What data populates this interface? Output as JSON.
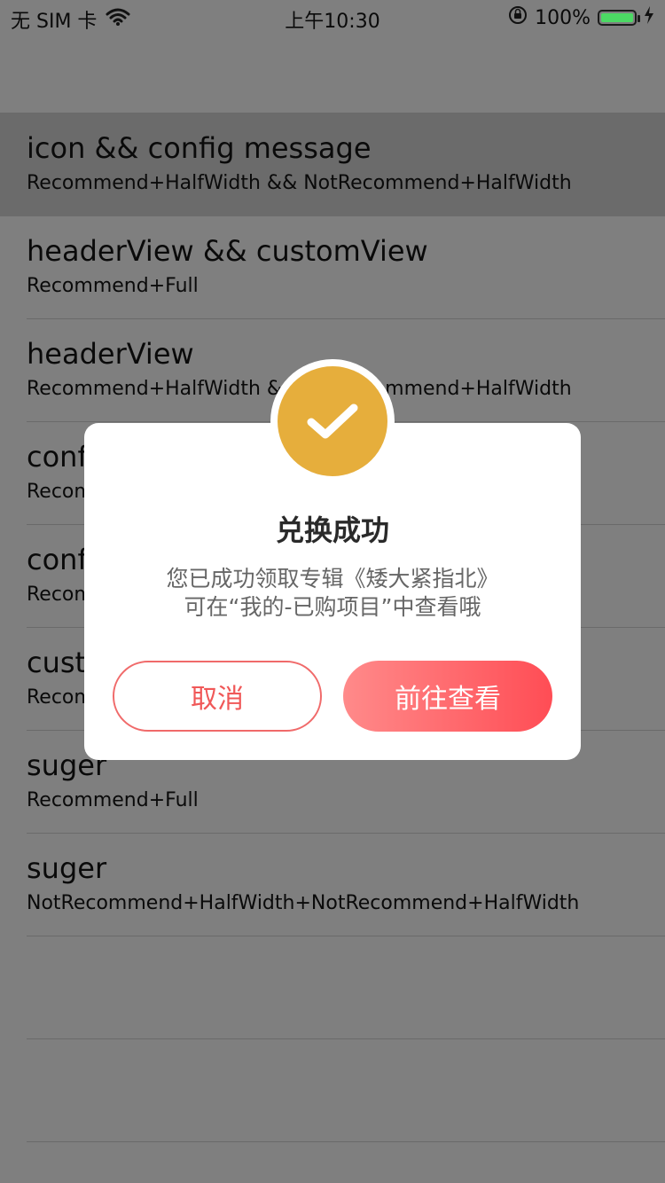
{
  "status_bar": {
    "carrier": "无 SIM 卡",
    "time": "上午10:30",
    "battery_percent": "100%",
    "battery_level": 1.0
  },
  "list": {
    "rows": [
      {
        "title": "icon && config message",
        "subtitle": "Recommend+HalfWidth && NotRecommend+HalfWidth"
      },
      {
        "title": "headerView && customView",
        "subtitle": "Recommend+Full"
      },
      {
        "title": "headerView",
        "subtitle": "Recommend+HalfWidth && NotRecommend+HalfWidth"
      },
      {
        "title": "conf",
        "subtitle": "Recom"
      },
      {
        "title": "conf",
        "subtitle": "Recom"
      },
      {
        "title": "cust",
        "subtitle": "Recom"
      },
      {
        "title": "suger",
        "subtitle": "Recommend+Full"
      },
      {
        "title": "suger",
        "subtitle": "NotRecommend+HalfWidth+NotRecommend+HalfWidth"
      },
      {
        "title": "",
        "subtitle": ""
      },
      {
        "title": "",
        "subtitle": ""
      }
    ]
  },
  "dialog": {
    "icon": "checkmark-icon",
    "title": "兑换成功",
    "message_line1": "您已成功领取专辑《矮大紧指北》",
    "message_line2": "可在“我的-已购项目”中查看哦",
    "cancel_label": "取消",
    "confirm_label": "前往查看"
  },
  "colors": {
    "accent": "#e6ae3c",
    "button_red": "#ff4d55",
    "overlay": "#7f7f7f"
  }
}
